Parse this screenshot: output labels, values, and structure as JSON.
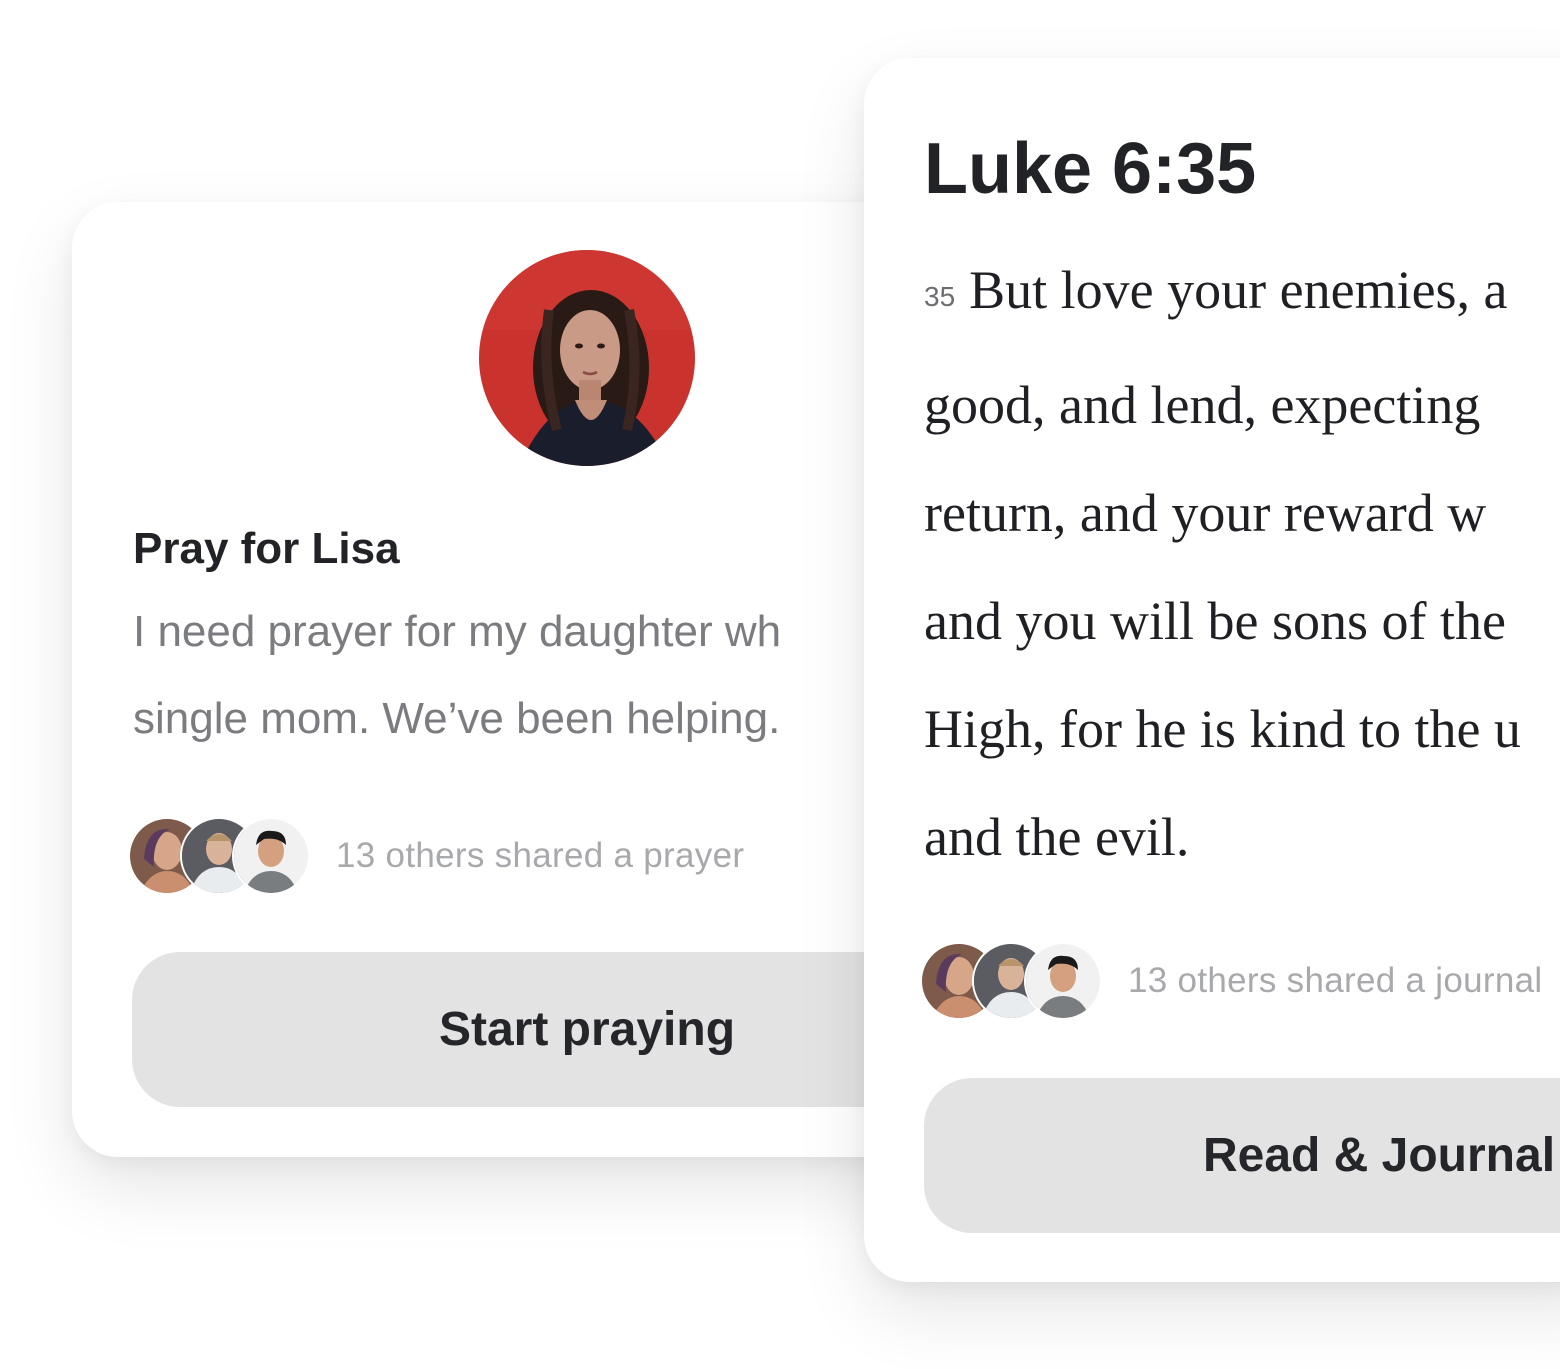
{
  "prayer_card": {
    "title": "Pray for Lisa",
    "body_lines": [
      "I need prayer for my daughter wh",
      "single mom. We’ve been helping."
    ],
    "others_text": "13 others shared a prayer",
    "button_label": "Start praying"
  },
  "verse_card": {
    "reference": "Luke 6:35",
    "verse_number": "35",
    "verse_lines": [
      "But love your enemies, a",
      "good, and lend, expecting",
      "return, and your reward w",
      "and you will be sons of the",
      "High, for he is kind to the u",
      "and the evil."
    ],
    "others_text": "13 others shared a journal",
    "button_label": "Read & Journal"
  },
  "colors": {
    "button_bg": "#e3e3e3",
    "title_text": "#222326",
    "muted_text": "#7b7c80",
    "faint_text": "#a8a9ad",
    "avatar_backdrop": "#c9322d"
  }
}
